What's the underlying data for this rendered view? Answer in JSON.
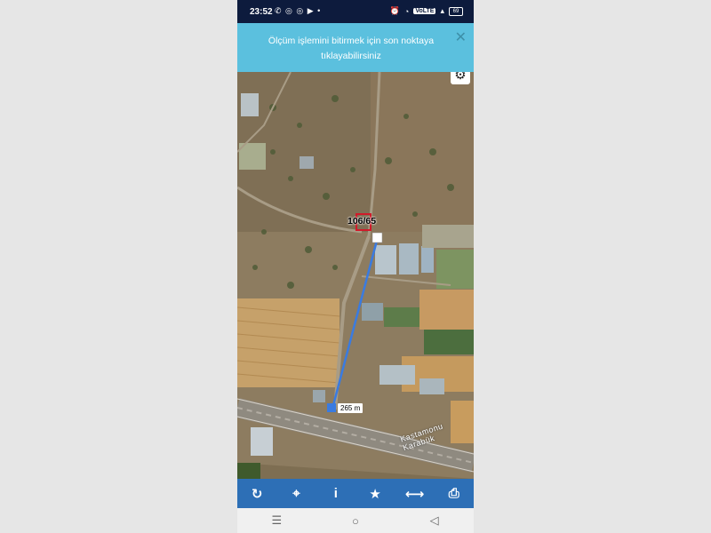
{
  "status_bar": {
    "time": "23:52",
    "app_icons": "✆ ◎ ◎ ▶ •",
    "network_badge": "VoLTE",
    "battery": "69"
  },
  "banner": {
    "message": "Ölçüm işlemini bitirmek için son noktaya tıklayabilirsiniz",
    "close_icon": "close-icon"
  },
  "map": {
    "parcel_label": "106/65",
    "distance_label": "265 m",
    "road_label": "Kastamonu Karabük",
    "settings_icon": "gear-icon",
    "measure_line_color": "#3a7be0"
  },
  "toolbar": {
    "items": [
      {
        "icon": "refresh-icon",
        "glyph": "↻"
      },
      {
        "icon": "locate-icon",
        "glyph": "⌖"
      },
      {
        "icon": "info-icon",
        "glyph": "i"
      },
      {
        "icon": "star-icon",
        "glyph": "★"
      },
      {
        "icon": "measure-icon",
        "glyph": "⟷"
      },
      {
        "icon": "print-icon",
        "glyph": "⎙"
      }
    ],
    "color": "#2d6fb6"
  },
  "nav_bar": {
    "recents_glyph": "☰",
    "home_glyph": "○",
    "back_glyph": "◁"
  }
}
